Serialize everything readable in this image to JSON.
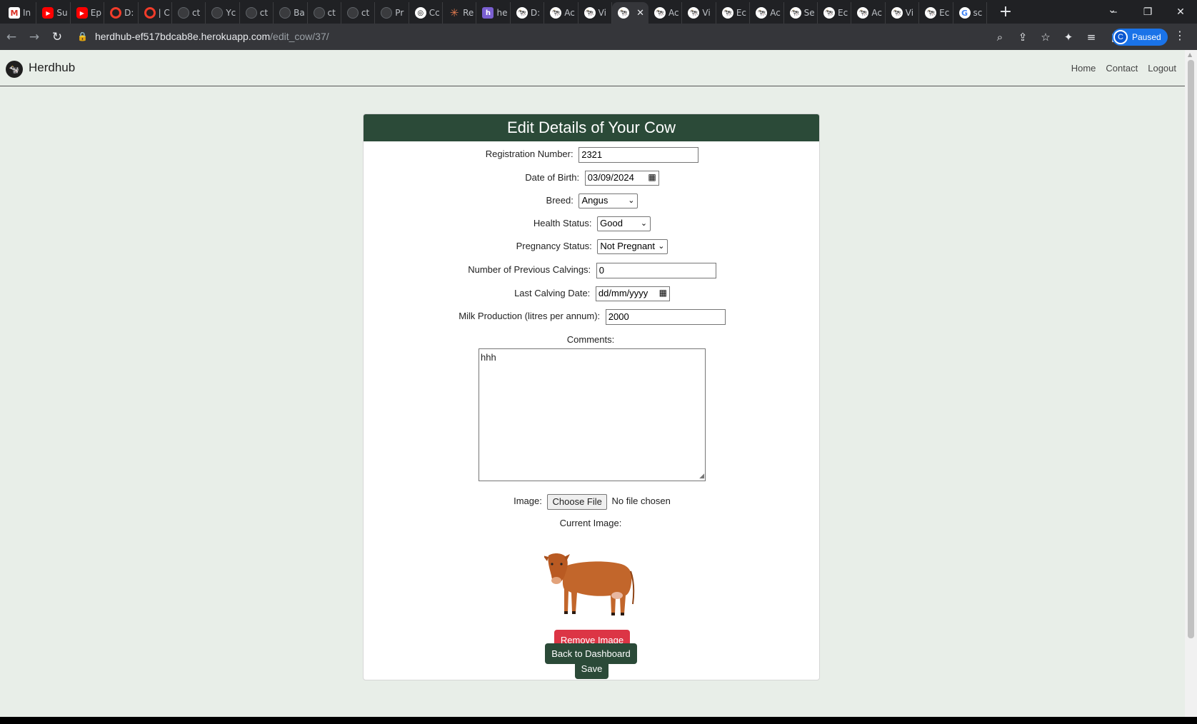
{
  "browser": {
    "tabs": [
      {
        "icon": "gmail-icon",
        "glyph": "M",
        "label": "In"
      },
      {
        "icon": "youtube-icon",
        "glyph": "▶",
        "label": "Su"
      },
      {
        "icon": "youtube-icon",
        "glyph": "▶",
        "label": "Ep"
      },
      {
        "icon": "ring-icon",
        "glyph": "",
        "label": "D:"
      },
      {
        "icon": "ring-icon",
        "glyph": "",
        "label": "| C"
      },
      {
        "icon": "github-icon",
        "glyph": "",
        "label": "ct"
      },
      {
        "icon": "github-icon",
        "glyph": "",
        "label": "Yc"
      },
      {
        "icon": "github-icon",
        "glyph": "",
        "label": "ct"
      },
      {
        "icon": "github-icon",
        "glyph": "",
        "label": "Ba"
      },
      {
        "icon": "github-icon",
        "glyph": "",
        "label": "ct"
      },
      {
        "icon": "github-icon",
        "glyph": "",
        "label": "ct"
      },
      {
        "icon": "github-icon",
        "glyph": "",
        "label": "Pr"
      },
      {
        "icon": "openai-icon",
        "glyph": "◎",
        "label": "Cc"
      },
      {
        "icon": "claude-icon",
        "glyph": "✳",
        "label": "Re"
      },
      {
        "icon": "heroku-icon",
        "glyph": "h",
        "label": "he"
      },
      {
        "icon": "herdhub-icon",
        "glyph": "🐄",
        "label": "D:"
      },
      {
        "icon": "herdhub-icon",
        "glyph": "🐄",
        "label": "Ac"
      },
      {
        "icon": "herdhub-icon",
        "glyph": "🐄",
        "label": "Vi"
      },
      {
        "icon": "herdhub-icon",
        "glyph": "🐄",
        "label": "",
        "active": true
      },
      {
        "icon": "herdhub-icon",
        "glyph": "🐄",
        "label": "Ac"
      },
      {
        "icon": "herdhub-icon",
        "glyph": "🐄",
        "label": "Vi"
      },
      {
        "icon": "herdhub-icon",
        "glyph": "🐄",
        "label": "Ec"
      },
      {
        "icon": "herdhub-icon",
        "glyph": "🐄",
        "label": "Ac"
      },
      {
        "icon": "herdhub-icon",
        "glyph": "🐄",
        "label": "Se"
      },
      {
        "icon": "herdhub-icon",
        "glyph": "🐄",
        "label": "Ec"
      },
      {
        "icon": "herdhub-icon",
        "glyph": "🐄",
        "label": "Ac"
      },
      {
        "icon": "herdhub-icon",
        "glyph": "🐄",
        "label": "Vi"
      },
      {
        "icon": "herdhub-icon",
        "glyph": "🐄",
        "label": "Ec"
      },
      {
        "icon": "google-icon",
        "glyph": "G",
        "label": "sc"
      }
    ],
    "url_host": "herdhub-ef517bdcab8e.herokuapp.com",
    "url_path": "/edit_cow/37/",
    "profile_initial": "C",
    "profile_status": "Paused"
  },
  "site": {
    "brand": "Herdhub",
    "nav": [
      "Home",
      "Contact",
      "Logout"
    ]
  },
  "form": {
    "title": "Edit Details of Your Cow",
    "registration_label": "Registration Number:",
    "registration_value": "2321",
    "dob_label": "Date of Birth:",
    "dob_value": "03/09/2024",
    "breed_label": "Breed:",
    "breed_value": "Angus",
    "health_label": "Health Status:",
    "health_value": "Good",
    "pregnancy_label": "Pregnancy Status:",
    "pregnancy_value": "Not Pregnant",
    "calvings_label": "Number of Previous Calvings:",
    "calvings_value": "0",
    "last_calving_label": "Last Calving Date:",
    "last_calving_placeholder": "dd/mm/yyyy",
    "milk_label": "Milk Production (litres per annum):",
    "milk_value": "2000",
    "comments_label": "Comments:",
    "comments_value": "hhh",
    "image_label": "Image:",
    "choose_file_label": "Choose File",
    "no_file_text": "No file chosen",
    "current_image_label": "Current Image:",
    "remove_image_label": "Remove Image",
    "save_label": "Save"
  },
  "back_label": "Back to Dashboard",
  "colors": {
    "accent": "#2b4a38",
    "danger": "#dc3545",
    "page_bg": "#e8eee8"
  }
}
